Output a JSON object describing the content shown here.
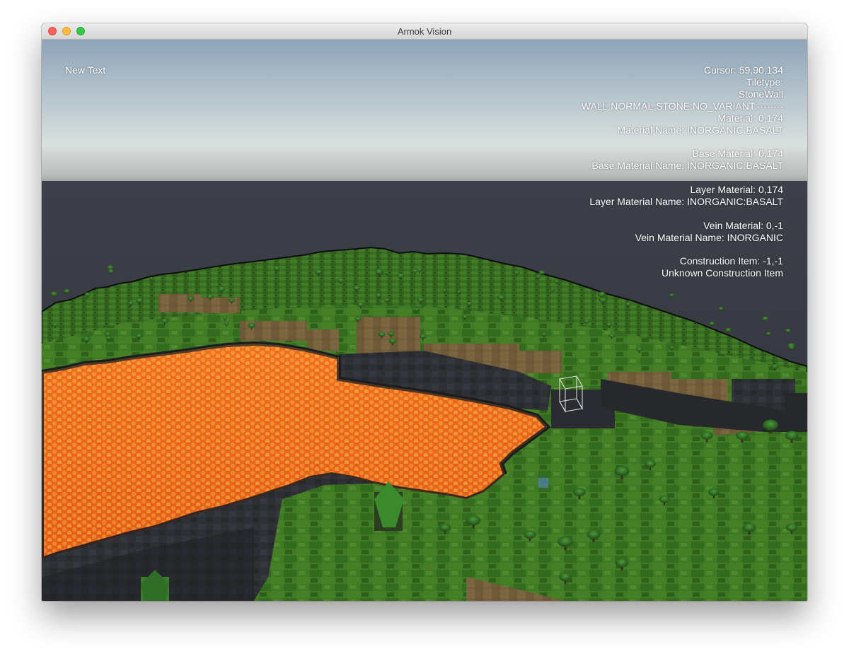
{
  "window": {
    "title": "Armok Vision",
    "buttons": [
      "close",
      "minimize",
      "maximize"
    ]
  },
  "hud": {
    "left_text": "New Text",
    "cursor": "Cursor: 59,90,134",
    "tiletype_label": "Tiletype:",
    "tiletype_value": "StoneWall",
    "tiletype_detail": "WALL:NORMAL:STONE:NO_VARIANT:--------",
    "material": "Material: 0,174",
    "material_name": "Material Name: INORGANIC:BASALT",
    "base_material": "Base Material: 0,174",
    "base_material_name": "Base Material Name: INORGANIC:BASALT",
    "layer_material": "Layer Material: 0,174",
    "layer_material_name": "Layer Material Name: INORGANIC:BASALT",
    "vein_material": "Vein Material: 0,-1",
    "vein_material_name": "Vein Material Name: INORGANIC",
    "construction_item": "Construction Item: -1,-1",
    "construction_item_name": "Unknown Construction Item"
  },
  "scene": {
    "sky_top": "#8fa6ba",
    "sky_horizon": "#d8dfdf",
    "fog": "#3b3e48",
    "lava": "#ee6a1e",
    "lava_highlight": "#f6a33a",
    "grass": "#3f7a22",
    "grass_dark": "#2c5619",
    "dirt": "#7a6440",
    "stone": "#2f3136"
  }
}
